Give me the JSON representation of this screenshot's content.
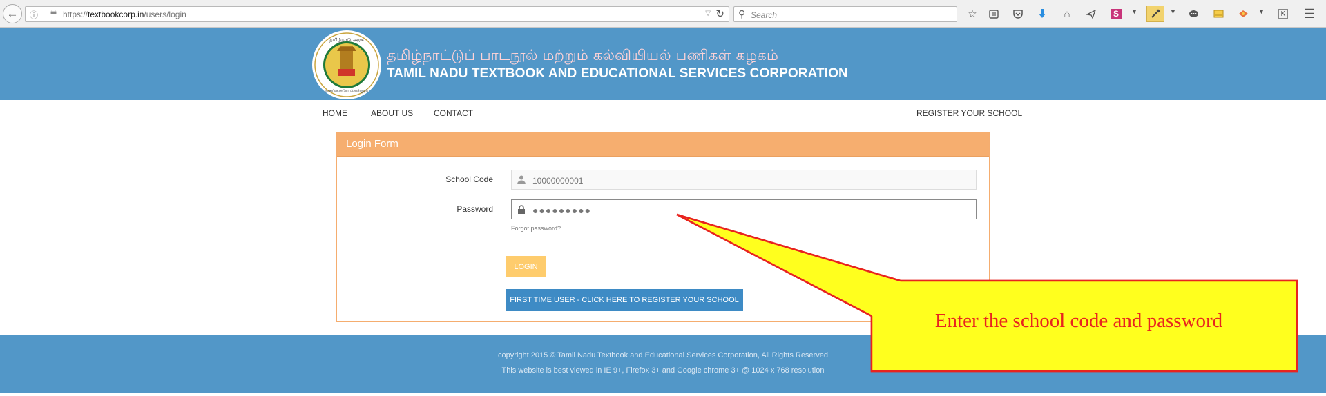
{
  "browser": {
    "url_prefix": "https://",
    "url_domain": "textbookcorp.in",
    "url_path": "/users/login",
    "search_placeholder": "Search"
  },
  "header": {
    "title_tamil": "தமிழ்நாட்டுப் பாடநூல் மற்றும் கல்வியியல் பணிகள் கழகம்",
    "title_english": "TAMIL NADU TEXTBOOK AND EDUCATIONAL SERVICES CORPORATION",
    "emblem_text": "தமிழ்நாடு அரசு",
    "emblem_motto": "வாய்மையே வெல்லும்"
  },
  "nav": {
    "home": "HOME",
    "about": "ABOUT US",
    "contact": "CONTACT",
    "register": "REGISTER YOUR SCHOOL"
  },
  "login_form": {
    "title": "Login Form",
    "school_code_label": "School Code",
    "school_code_placeholder": "10000000001",
    "password_label": "Password",
    "password_value": "●●●●●●●●●",
    "forgot_link": "Forgot password?",
    "login_button": "LOGIN",
    "register_button": "FIRST TIME USER - CLICK HERE TO REGISTER YOUR SCHOOL"
  },
  "footer": {
    "copyright": "copyright 2015 © Tamil Nadu Textbook and Educational Services Corporation, All Rights Reserved",
    "note": "This website is best viewed in IE 9+, Firefox 3+ and Google chrome 3+ @ 1024 x 768 resolution"
  },
  "callout": {
    "text": "Enter the school code and password"
  },
  "colors": {
    "header_blue": "#5297c8",
    "panel_orange": "#f6ae6f",
    "login_yellow": "#fecc6d",
    "register_blue": "#3e8bc5",
    "callout_fill": "#ffff1e",
    "callout_stroke": "#e8231f"
  },
  "toolbar_icons": [
    "bookmark-star-icon",
    "reading-list-icon",
    "pocket-icon",
    "download-icon",
    "home-icon",
    "share-icon",
    "s-extension-icon",
    "eyedropper-icon",
    "chat-icon",
    "screenshot-icon",
    "tools-icon",
    "k-extension-icon",
    "menu-icon"
  ]
}
